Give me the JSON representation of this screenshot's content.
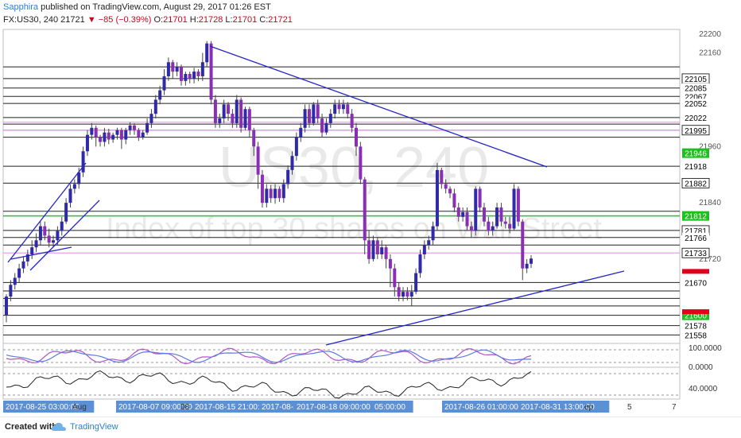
{
  "header": {
    "author": "Sapphira",
    "published_text": "published on TradingView.com, August 29, 2017 01:26 EST",
    "symbol": "FX:US30, 240",
    "last": "21721",
    "change": "▼ −85 (−0.39%)",
    "o_label": "O:",
    "o_value": "21701",
    "h_label": "H:",
    "h_value": "21728",
    "l_label": "L:",
    "l_value": "21701",
    "c_label": "C:",
    "c_value": "21721"
  },
  "watermark": {
    "symbol": "US30, 240",
    "description": "Index of top 30 shares on Wall Street"
  },
  "colors": {
    "bull": "#2e2aa8",
    "bear": "#8a2fb5",
    "trend": "#2525c8",
    "rsi_purple": "#b054c8",
    "rsi_blue": "#5b7be0",
    "hline_pink": "#e8a0e8",
    "hline_green": "#22c422",
    "label_green": "#1fbf1f",
    "label_red": "#e0001b",
    "axis_blue": "#5b8fd6",
    "gold": "#e6b800"
  },
  "footer": {
    "created": "Created with",
    "brand": "TradingView"
  },
  "chart_data": {
    "type": "candlestick",
    "ylim": [
      21540,
      22210
    ],
    "y_ticks": [
      22200,
      22160,
      21960,
      21840,
      21720
    ],
    "price_labels": [
      {
        "value": 22105,
        "text": "22105",
        "style": "black"
      },
      {
        "value": 22085,
        "text": "22085",
        "style": "plain"
      },
      {
        "value": 22067,
        "text": "22067",
        "style": "plain"
      },
      {
        "value": 22052,
        "text": "22052",
        "style": "plain"
      },
      {
        "value": 22022,
        "text": "22022",
        "style": "plain"
      },
      {
        "value": 21995,
        "text": "21995",
        "style": "black"
      },
      {
        "value": 21946,
        "text": "21946",
        "style": "green"
      },
      {
        "value": 21918,
        "text": "21918",
        "style": "plain"
      },
      {
        "value": 21882,
        "text": "21882",
        "style": "black"
      },
      {
        "value": 21812,
        "text": "21812",
        "style": "green"
      },
      {
        "value": 21781,
        "text": "21781",
        "style": "black"
      },
      {
        "value": 21766,
        "text": "21766",
        "style": "plain"
      },
      {
        "value": 21733,
        "text": "21733",
        "style": "black"
      },
      {
        "value": 21670,
        "text": "21670",
        "style": "plain"
      },
      {
        "value": 21600,
        "text": "21600",
        "style": "green"
      },
      {
        "value": 21578,
        "text": "21578",
        "style": "plain"
      },
      {
        "value": 21558,
        "text": "21558",
        "style": "plain"
      }
    ],
    "h_lines": [
      22130,
      22105,
      22085,
      22067,
      22052,
      22022,
      22008,
      21995,
      21980,
      21918,
      21882,
      21822,
      21781,
      21766,
      21750,
      21670,
      21652,
      21636,
      21620,
      21600,
      21578,
      21558
    ],
    "pink_lines": [
      22012,
      21995,
      21733
    ],
    "green_lines": [
      21812
    ],
    "x_labels": [
      "2017-08-25 03:00:00",
      "Aug",
      "2017-08-07 09:00:00",
      "08 2",
      "2017-08-15 21:00:00",
      "2017-08-18",
      "2017-08-18 09:00:00",
      "05:00:00",
      "2017-08-26 01:00:00",
      "2017-08-31 13:00:00",
      "ep",
      "5",
      "7"
    ],
    "indicator1": {
      "ticks": [
        "100.0000",
        "0.0000"
      ]
    },
    "indicator2": {
      "ticks": [
        "40.0000"
      ]
    },
    "candles": [
      [
        21600,
        21640,
        21585,
        21645
      ],
      [
        21640,
        21665,
        21630,
        21675
      ],
      [
        21665,
        21680,
        21655,
        21690
      ],
      [
        21680,
        21700,
        21670,
        21710
      ],
      [
        21700,
        21715,
        21690,
        21725
      ],
      [
        21715,
        21730,
        21705,
        21740
      ],
      [
        21730,
        21745,
        21720,
        21760
      ],
      [
        21745,
        21760,
        21735,
        21775
      ],
      [
        21760,
        21790,
        21750,
        21800
      ],
      [
        21790,
        21770,
        21760,
        21800
      ],
      [
        21770,
        21755,
        21745,
        21785
      ],
      [
        21755,
        21760,
        21745,
        21770
      ],
      [
        21760,
        21780,
        21750,
        21790
      ],
      [
        21780,
        21800,
        21770,
        21810
      ],
      [
        21800,
        21840,
        21795,
        21850
      ],
      [
        21840,
        21870,
        21830,
        21880
      ],
      [
        21870,
        21880,
        21860,
        21890
      ],
      [
        21880,
        21905,
        21870,
        21915
      ],
      [
        21905,
        21950,
        21895,
        21960
      ],
      [
        21950,
        21985,
        21940,
        21995
      ],
      [
        21985,
        22000,
        21975,
        22010
      ],
      [
        22000,
        21980,
        21960,
        22005
      ],
      [
        21980,
        21970,
        21960,
        21985
      ],
      [
        21970,
        21990,
        21960,
        22000
      ],
      [
        21990,
        21975,
        21965,
        21998
      ],
      [
        21975,
        21985,
        21968,
        21990
      ],
      [
        21985,
        21995,
        21975,
        22000
      ],
      [
        21995,
        21975,
        21955,
        22000
      ],
      [
        21975,
        21995,
        21965,
        22000
      ],
      [
        21995,
        22005,
        21985,
        22012
      ],
      [
        22005,
        21995,
        21985,
        22010
      ],
      [
        21995,
        21980,
        21972,
        22000
      ],
      [
        21980,
        21990,
        21975,
        21995
      ],
      [
        21990,
        22010,
        21985,
        22020
      ],
      [
        22010,
        22030,
        22000,
        22040
      ],
      [
        22030,
        22060,
        22020,
        22070
      ],
      [
        22060,
        22080,
        22050,
        22090
      ],
      [
        22080,
        22110,
        22070,
        22125
      ],
      [
        22110,
        22140,
        22100,
        22150
      ],
      [
        22140,
        22120,
        22105,
        22145
      ],
      [
        22120,
        22130,
        22110,
        22140
      ],
      [
        22130,
        22100,
        22090,
        22135
      ],
      [
        22100,
        22115,
        22090,
        22120
      ],
      [
        22115,
        22105,
        22095,
        22120
      ],
      [
        22105,
        22120,
        22095,
        22128
      ],
      [
        22120,
        22110,
        22100,
        22125
      ],
      [
        22110,
        22140,
        22100,
        22160
      ],
      [
        22140,
        22180,
        22130,
        22185
      ],
      [
        22180,
        22060,
        22050,
        22185
      ],
      [
        22060,
        22010,
        22000,
        22070
      ],
      [
        22010,
        22020,
        22000,
        22030
      ],
      [
        22020,
        22050,
        22010,
        22060
      ],
      [
        22050,
        22030,
        22015,
        22055
      ],
      [
        22030,
        22010,
        22000,
        22040
      ],
      [
        22010,
        22060,
        22000,
        22070
      ],
      [
        22060,
        22000,
        21990,
        22065
      ],
      [
        22000,
        22040,
        21995,
        22045
      ],
      [
        22040,
        21995,
        21980,
        22045
      ],
      [
        21995,
        21960,
        21940,
        22000
      ],
      [
        21960,
        21900,
        21870,
        21970
      ],
      [
        21900,
        21840,
        21830,
        21910
      ],
      [
        21840,
        21870,
        21830,
        21880
      ],
      [
        21870,
        21850,
        21840,
        21878
      ],
      [
        21850,
        21870,
        21838,
        21880
      ],
      [
        21870,
        21850,
        21842,
        21875
      ],
      [
        21850,
        21880,
        21840,
        21890
      ],
      [
        21880,
        21910,
        21870,
        21920
      ],
      [
        21910,
        21940,
        21900,
        21950
      ],
      [
        21940,
        21980,
        21930,
        21990
      ],
      [
        21980,
        22000,
        21970,
        22010
      ],
      [
        22000,
        22040,
        21990,
        22050
      ],
      [
        22040,
        22010,
        22000,
        22050
      ],
      [
        22010,
        22050,
        22005,
        22055
      ],
      [
        22050,
        22020,
        22010,
        22060
      ],
      [
        22020,
        21990,
        21980,
        22030
      ],
      [
        21990,
        22010,
        21985,
        22020
      ],
      [
        22010,
        22030,
        22000,
        22040
      ],
      [
        22030,
        22050,
        22020,
        22060
      ],
      [
        22050,
        22040,
        22030,
        22060
      ],
      [
        22040,
        22050,
        22030,
        22060
      ],
      [
        22050,
        22030,
        22020,
        22055
      ],
      [
        22030,
        22000,
        21990,
        22040
      ],
      [
        22000,
        21960,
        21940,
        22010
      ],
      [
        21960,
        21890,
        21880,
        21970
      ],
      [
        21890,
        21760,
        21730,
        21895
      ],
      [
        21760,
        21720,
        21710,
        21780
      ],
      [
        21720,
        21760,
        21715,
        21770
      ],
      [
        21760,
        21730,
        21720,
        21765
      ],
      [
        21730,
        21745,
        21720,
        21760
      ],
      [
        21745,
        21720,
        21700,
        21750
      ],
      [
        21720,
        21700,
        21660,
        21730
      ],
      [
        21700,
        21660,
        21640,
        21710
      ],
      [
        21660,
        21640,
        21630,
        21670
      ],
      [
        21640,
        21650,
        21630,
        21660
      ],
      [
        21650,
        21640,
        21632,
        21660
      ],
      [
        21640,
        21650,
        21620,
        21665
      ],
      [
        21650,
        21690,
        21645,
        21700
      ],
      [
        21690,
        21730,
        21680,
        21740
      ],
      [
        21730,
        21750,
        21720,
        21760
      ],
      [
        21750,
        21760,
        21740,
        21770
      ],
      [
        21760,
        21790,
        21750,
        21800
      ],
      [
        21790,
        21910,
        21780,
        21925
      ],
      [
        21910,
        21880,
        21870,
        21915
      ],
      [
        21880,
        21870,
        21860,
        21890
      ],
      [
        21870,
        21860,
        21850,
        21875
      ],
      [
        21860,
        21830,
        21820,
        21870
      ],
      [
        21830,
        21810,
        21800,
        21840
      ],
      [
        21810,
        21820,
        21800,
        21830
      ],
      [
        21820,
        21790,
        21780,
        21830
      ],
      [
        21790,
        21780,
        21765,
        21800
      ],
      [
        21780,
        21870,
        21770,
        21875
      ],
      [
        21870,
        21830,
        21820,
        21875
      ],
      [
        21830,
        21800,
        21790,
        21840
      ],
      [
        21800,
        21780,
        21770,
        21810
      ],
      [
        21780,
        21790,
        21770,
        21800
      ],
      [
        21790,
        21830,
        21785,
        21840
      ],
      [
        21830,
        21800,
        21790,
        21840
      ],
      [
        21800,
        21795,
        21785,
        21810
      ],
      [
        21795,
        21785,
        21775,
        21810
      ],
      [
        21785,
        21870,
        21780,
        21880
      ],
      [
        21870,
        21800,
        21790,
        21875
      ],
      [
        21800,
        21700,
        21675,
        21805
      ],
      [
        21700,
        21710,
        21690,
        21720
      ],
      [
        21710,
        21721,
        21701,
        21728
      ]
    ]
  }
}
